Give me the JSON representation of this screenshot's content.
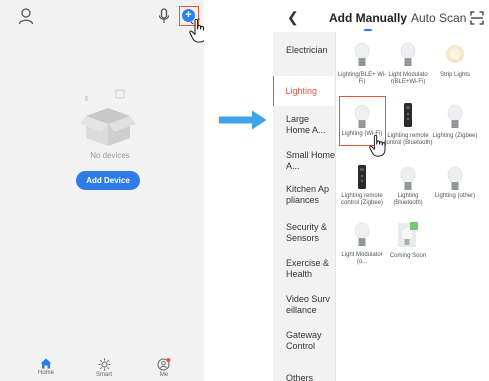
{
  "left_screen": {
    "empty_message": "No devices",
    "add_device_label": "Add Device",
    "nav": [
      {
        "label": "Home",
        "icon": "home-icon",
        "active": true
      },
      {
        "label": "Smart",
        "icon": "sun-icon",
        "active": false
      },
      {
        "label": "Me",
        "icon": "profile-icon",
        "active": false
      }
    ],
    "colors": {
      "accent": "#2f7be8",
      "highlight": "#e8553b",
      "background": "#f2f2f2"
    }
  },
  "right_screen": {
    "tabs": {
      "manual": "Add Manually",
      "auto": "Auto Scan"
    },
    "categories": [
      {
        "label": "Electrician",
        "selected": false
      },
      {
        "label": "Lighting",
        "selected": true
      },
      {
        "label": "Large Home A...",
        "selected": false
      },
      {
        "label": "Small Home A...",
        "selected": false
      },
      {
        "label": "Kitchen Ap pliances",
        "selected": false
      },
      {
        "label": "Security & Sensors",
        "selected": false
      },
      {
        "label": "Exercise & Health",
        "selected": false
      },
      {
        "label": "Video Surv eillance",
        "selected": false
      },
      {
        "label": "Gateway Control",
        "selected": false
      },
      {
        "label": "Others",
        "selected": false
      }
    ],
    "products": [
      {
        "label": "Lighting(BLE+ Wi-Fi)",
        "icon": "bulb-icon"
      },
      {
        "label": "Light Modulato r(BLE+Wi-Fi)",
        "icon": "bulb-icon"
      },
      {
        "label": "Strip Lights",
        "icon": "strip-light-icon"
      },
      {
        "label": "Lighting (Wi-Fi)",
        "icon": "bulb-icon",
        "highlighted": true
      },
      {
        "label": "Lighting remote control (Bluetooth)",
        "icon": "remote-icon"
      },
      {
        "label": "Lighting (Zigbee)",
        "icon": "bulb-icon"
      },
      {
        "label": "Lighting remote control (Zigbee)",
        "icon": "remote-icon"
      },
      {
        "label": "Lighting (Bluetooth)",
        "icon": "bulb-icon"
      },
      {
        "label": "Lighting (other)",
        "icon": "bulb-icon"
      },
      {
        "label": "Light Modulator (o...",
        "icon": "bulb-icon"
      },
      {
        "label": "Coming Soon",
        "icon": "coming-soon-icon"
      }
    ]
  }
}
